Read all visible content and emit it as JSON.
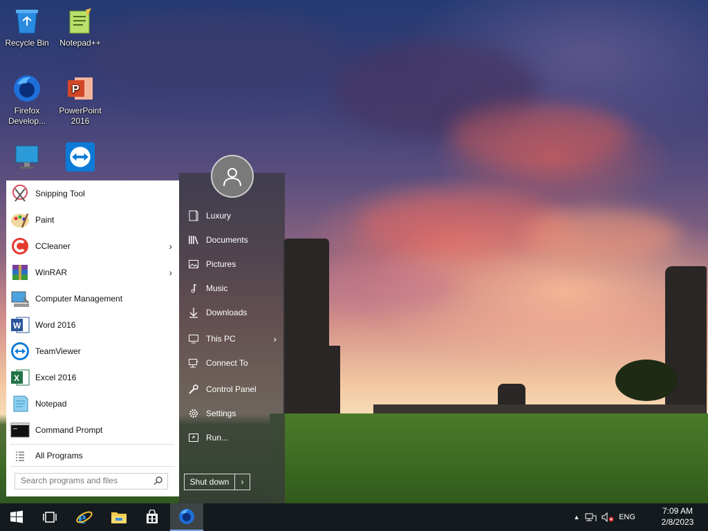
{
  "desktop": {
    "icons": [
      {
        "label": "Recycle Bin"
      },
      {
        "label": "Notepad++"
      },
      {
        "label": "Firefox\nDevelop..."
      },
      {
        "label": "PowerPoint\n2016"
      },
      {
        "label": ""
      },
      {
        "label": ""
      }
    ]
  },
  "start_menu": {
    "programs": [
      {
        "label": "Snipping Tool",
        "icon": "snipping-tool-icon"
      },
      {
        "label": "Paint",
        "icon": "paint-icon"
      },
      {
        "label": "CCleaner",
        "icon": "ccleaner-icon",
        "submenu": true
      },
      {
        "label": "WinRAR",
        "icon": "winrar-icon",
        "submenu": true
      },
      {
        "label": "Computer Management",
        "icon": "computer-management-icon"
      },
      {
        "label": "Word 2016",
        "icon": "word-icon"
      },
      {
        "label": "TeamViewer",
        "icon": "teamviewer-icon"
      },
      {
        "label": "Excel 2016",
        "icon": "excel-icon"
      },
      {
        "label": "Notepad",
        "icon": "notepad-icon"
      },
      {
        "label": "Command Prompt",
        "icon": "command-prompt-icon"
      }
    ],
    "all_programs": "All Programs",
    "search_placeholder": "Search programs and files",
    "places": [
      {
        "label": "Luxury",
        "icon": "user-folder-icon"
      },
      {
        "label": "Documents",
        "icon": "documents-icon"
      },
      {
        "label": "Pictures",
        "icon": "pictures-icon"
      },
      {
        "label": "Music",
        "icon": "music-icon"
      },
      {
        "label": "Downloads",
        "icon": "downloads-icon"
      },
      {
        "label": "This PC",
        "icon": "this-pc-icon",
        "submenu": true
      },
      {
        "label": "Connect To",
        "icon": "connect-to-icon"
      },
      {
        "label": "Control Panel",
        "icon": "control-panel-icon"
      },
      {
        "label": "Settings",
        "icon": "settings-icon"
      },
      {
        "label": "Run...",
        "icon": "run-icon"
      }
    ],
    "shutdown_label": "Shut down"
  },
  "taskbar": {
    "language": "ENG",
    "time": "7:09 AM",
    "date": "2/8/2023"
  }
}
